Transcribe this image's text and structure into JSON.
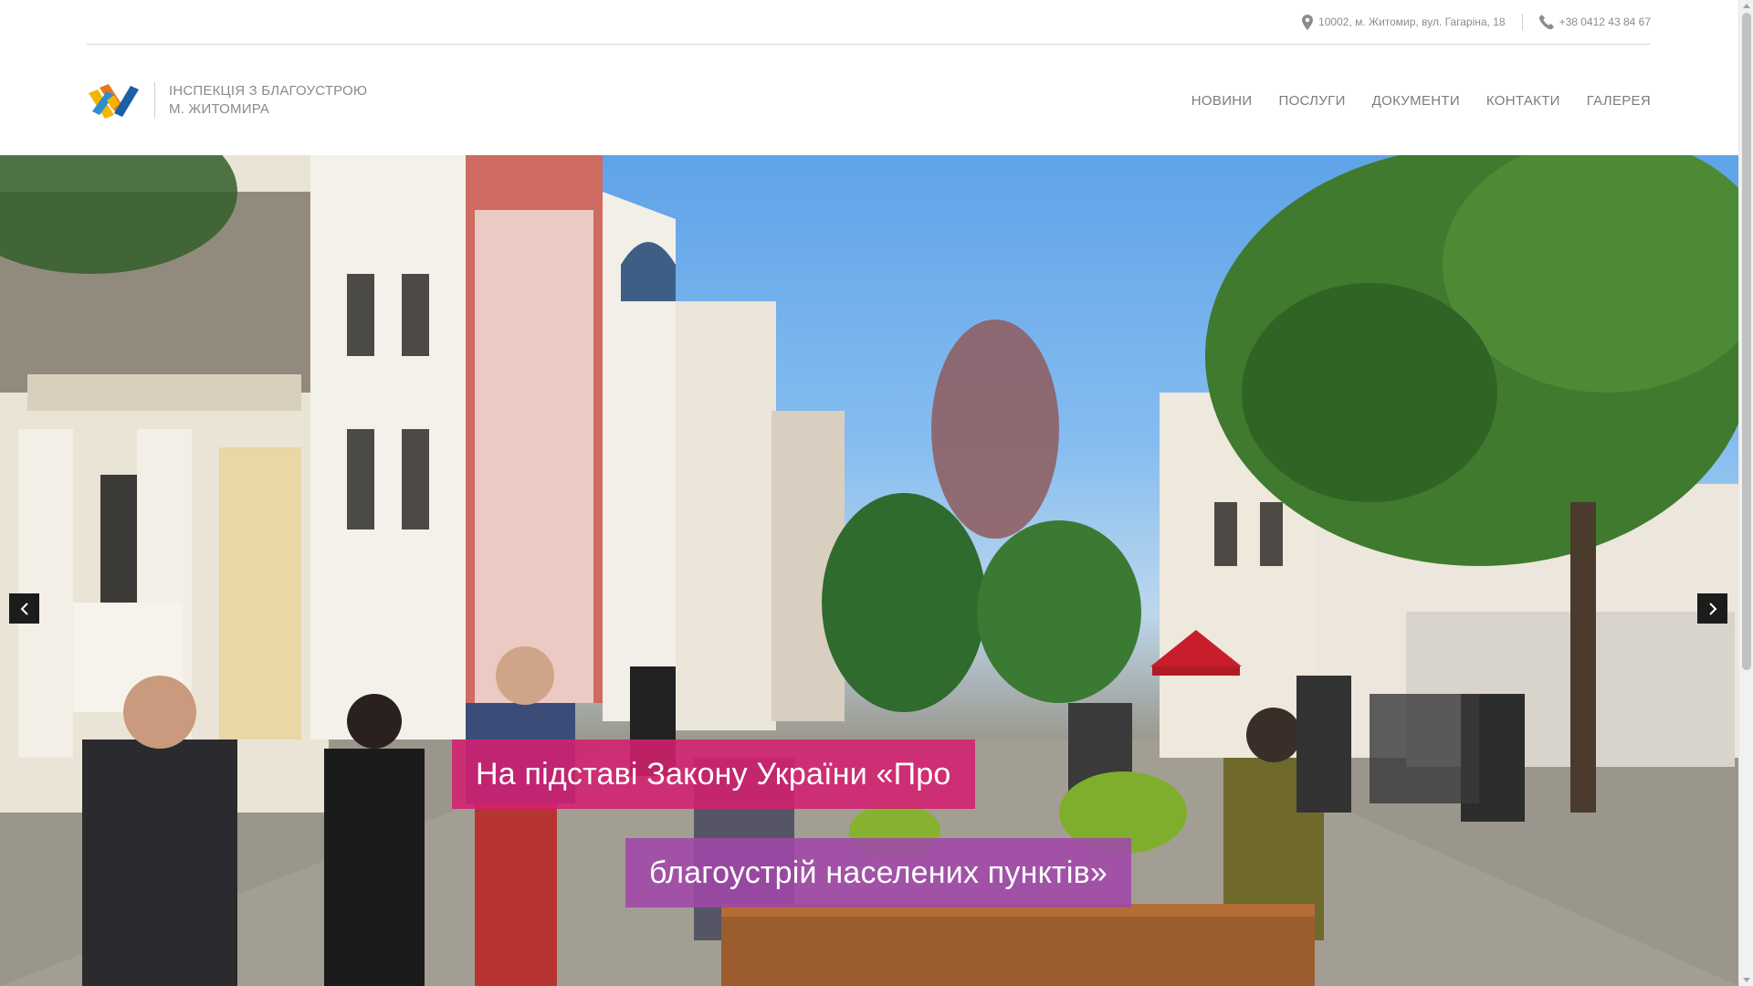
{
  "topbar": {
    "address": "10002, м. Житомир, вул. Гагаріна, 18",
    "phone": "+38 0412 43 84 67",
    "address_icon": "map-pin-icon",
    "phone_icon": "phone-icon"
  },
  "brand": {
    "line1": "ІНСПЕКЦІЯ З БЛАГОУСТРОЮ",
    "line2": "М. ЖИТОМИРА",
    "logo_colors": [
      "#f5b400",
      "#2a8fd0",
      "#e8771c",
      "#1d5fa6"
    ]
  },
  "nav": {
    "items": [
      {
        "label": "НОВИНИ"
      },
      {
        "label": "ПОСЛУГИ"
      },
      {
        "label": "ДОКУМЕНТИ"
      },
      {
        "label": "КОНТАКТИ"
      },
      {
        "label": "ГАЛЕРЕЯ"
      }
    ]
  },
  "slider": {
    "caption_line1": "На підставі Закону України «Про",
    "caption_line2": "благоустрій населених пунктів»",
    "prev_icon": "chevron-left-icon",
    "next_icon": "chevron-right-icon",
    "caption_color_1": "#d42070",
    "caption_color_2": "#a048aa"
  }
}
